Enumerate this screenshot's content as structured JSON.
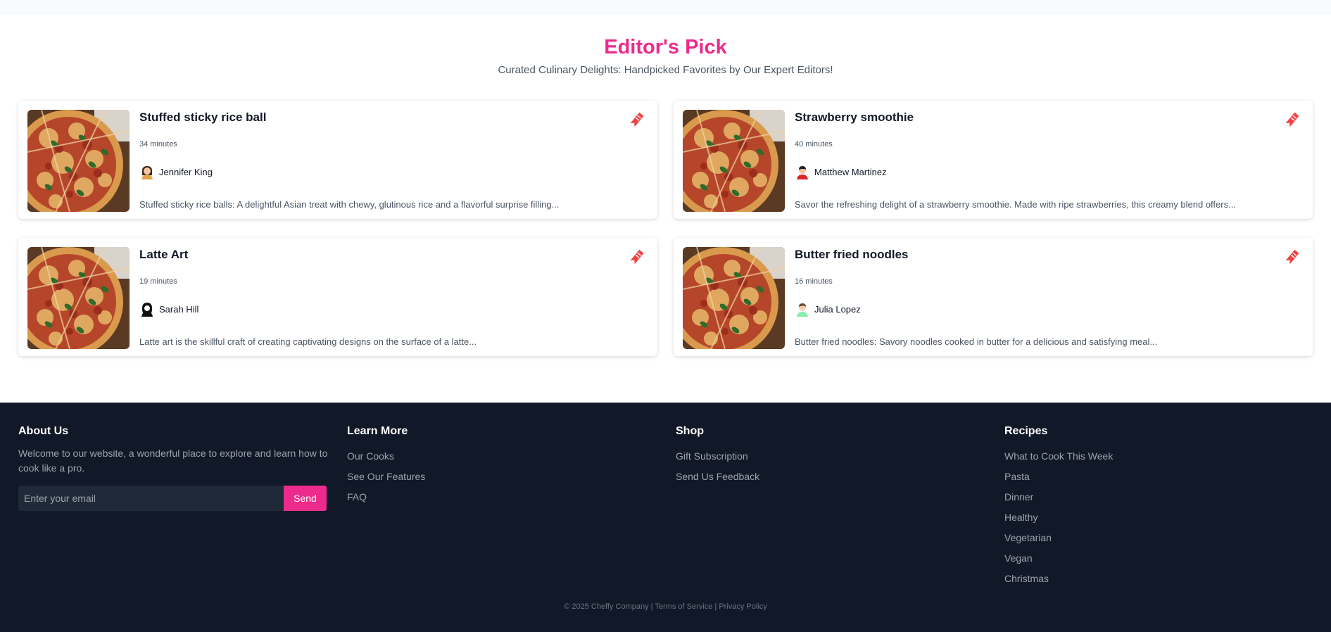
{
  "section": {
    "title": "Editor's Pick",
    "subtitle": "Curated Culinary Delights: Handpicked Favorites by Our Expert Editors!"
  },
  "recipes": [
    {
      "title": "Stuffed sticky rice ball",
      "time": "34 minutes",
      "author": "Jennifer King",
      "avatar_icon": "woman-avatar-icon",
      "description": "Stuffed sticky rice balls: A delightful Asian treat with chewy, glutinous rice and a flavorful surprise filling..."
    },
    {
      "title": "Strawberry smoothie",
      "time": "40 minutes",
      "author": "Matthew Martinez",
      "avatar_icon": "man-avatar-icon",
      "description": "Savor the refreshing delight of a strawberry smoothie. Made with ripe strawberries, this creamy blend offers..."
    },
    {
      "title": "Latte Art",
      "time": "19 minutes",
      "author": "Sarah Hill",
      "avatar_icon": "woman-avatar-icon",
      "description": "Latte art is the skillful craft of creating captivating designs on the surface of a latte..."
    },
    {
      "title": "Butter fried noodles",
      "time": "16 minutes",
      "author": "Julia Lopez",
      "avatar_icon": "person-avatar-icon",
      "description": "Butter fried noodles: Savory noodles cooked in butter for a delicious and satisfying meal..."
    }
  ],
  "footer": {
    "about": {
      "heading": "About Us",
      "text": "Welcome to our website, a wonderful place to explore and learn how to cook like a pro.",
      "email_placeholder": "Enter your email",
      "send_label": "Send"
    },
    "learn_more": {
      "heading": "Learn More",
      "links": [
        "Our Cooks",
        "See Our Features",
        "FAQ"
      ]
    },
    "shop": {
      "heading": "Shop",
      "links": [
        "Gift Subscription",
        "Send Us Feedback"
      ]
    },
    "recipes": {
      "heading": "Recipes",
      "links": [
        "What to Cook This Week",
        "Pasta",
        "Dinner",
        "Healthy",
        "Vegetarian",
        "Vegan",
        "Christmas"
      ]
    },
    "copyright": {
      "text": "© 2025 Cheffy Company",
      "separator": " | ",
      "terms": "Terms of Service",
      "privacy": "Privacy Policy"
    }
  },
  "colors": {
    "accent": "#ec2b8c",
    "footer_bg": "#111827",
    "bookmark": "#ef4444"
  }
}
